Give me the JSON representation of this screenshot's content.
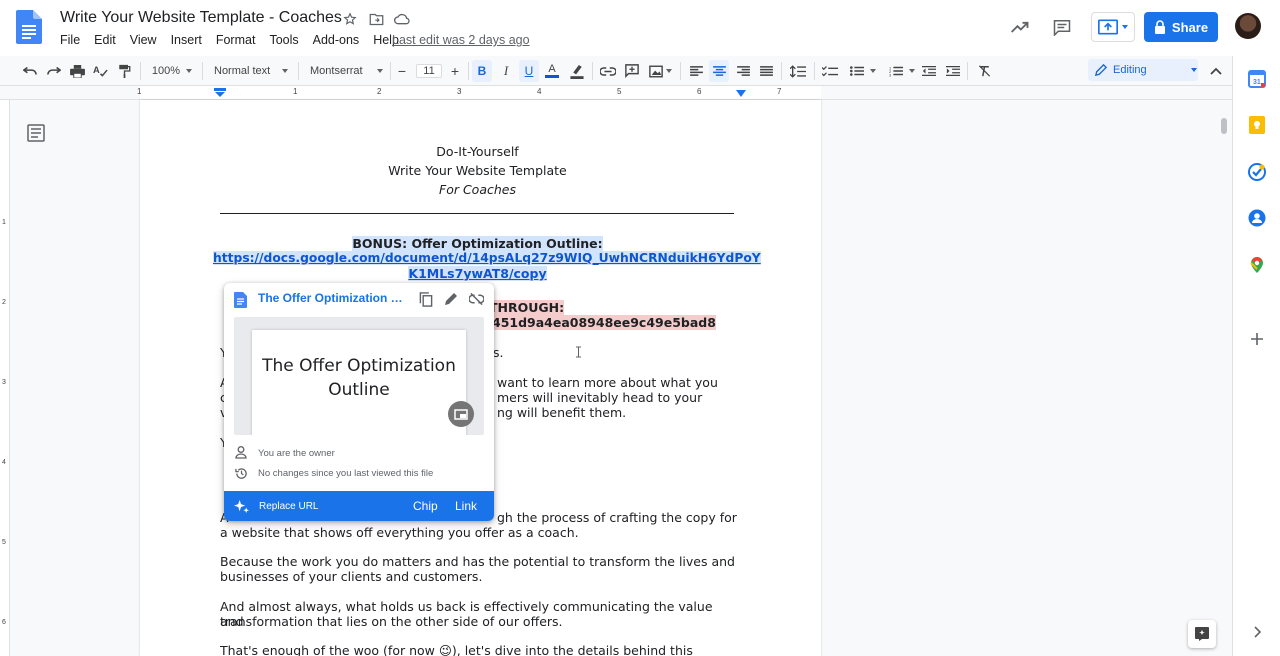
{
  "header": {
    "title": "Write Your Website Template - Coaches",
    "menu": [
      "File",
      "Edit",
      "View",
      "Insert",
      "Format",
      "Tools",
      "Add-ons",
      "Help"
    ],
    "last_edit": "Last edit was 2 days ago",
    "share_label": "Share"
  },
  "toolbar": {
    "zoom": "100%",
    "style": "Normal text",
    "font": "Montserrat",
    "font_size": "11",
    "mode": "Editing"
  },
  "ruler": {
    "marks": [
      "1",
      "1",
      "2",
      "3",
      "4",
      "5",
      "6",
      "7"
    ]
  },
  "vruler": {
    "marks": [
      "1",
      "2",
      "3",
      "4",
      "5",
      "6"
    ]
  },
  "doc": {
    "heading1": "Do-It-Yourself",
    "heading2": "Write Your Website Template",
    "heading3": "For Coaches",
    "bonus_label": "BONUS: Offer Optimization Outline:",
    "bonus_url_1": "https://docs.google.com/document/d/14psALq27z9WIQ_UwhNCRNduikH6YdPoY",
    "bonus_url_2": "K1MLs7ywAT8/copy",
    "walk_label": "THROUGH:",
    "walk_url": "451d9a4ea08948ee9c49e5bad8",
    "frag_y1": "Y",
    "frag_s": "s.",
    "frag_a1": "A",
    "p1_line1": "want to learn more about what you",
    "p1_line2": "mers will inevitably head to your",
    "p1_line3": "ng will benefit them.",
    "frag_c": "c",
    "frag_v": "v",
    "frag_y2": "Y",
    "frag_a2": "A",
    "p2_line1": "gh the process of crafting the copy for",
    "p2_line2": "a website that shows off everything you offer as a coach.",
    "p3_line1": "Because the work you do matters and has the potential to transform the lives and",
    "p3_line2": "businesses of your clients and customers.",
    "p4_line1": "And almost always, what holds us back is effectively communicating the value and",
    "p4_line2": "transformation that lies on the other side of our offers.",
    "p5_line1": "That's enough of the woo (for now 😉), let's dive into the details behind this"
  },
  "popup": {
    "title": "The Offer Optimization Outline",
    "thumb_title": "The Offer Optimization Outline",
    "owner": "You are the owner",
    "changes": "No changes since you last viewed this file",
    "replace": "Replace URL",
    "chip": "Chip",
    "link": "Link"
  },
  "colors": {
    "accent": "#1a73e8",
    "link": "#1155cc",
    "highlight_blue": "#d2e3fc",
    "highlight_red": "#f4cccc"
  },
  "side_panel": {
    "icons": [
      "calendar-icon",
      "keep-icon",
      "tasks-icon",
      "contacts-icon",
      "maps-icon",
      "add-icon"
    ]
  }
}
